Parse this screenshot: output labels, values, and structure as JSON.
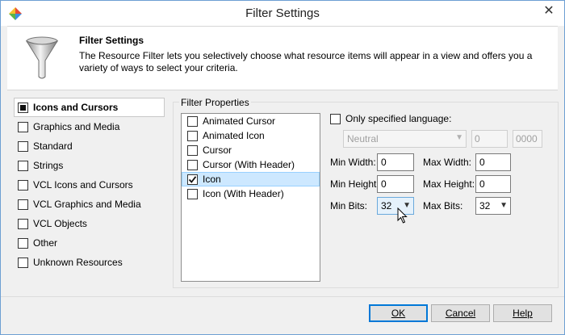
{
  "window": {
    "title": "Filter Settings",
    "close_symbol": "✕"
  },
  "header": {
    "title": "Filter Settings",
    "description": "The Resource Filter lets you selectively choose what resource items will appear in a view and offers you  a variety of ways to select your criteria."
  },
  "categories": [
    {
      "label": "Icons and Cursors",
      "checked": "partial",
      "selected": true
    },
    {
      "label": "Graphics and Media",
      "checked": false
    },
    {
      "label": "Standard",
      "checked": false
    },
    {
      "label": "Strings",
      "checked": false
    },
    {
      "label": "VCL Icons and Cursors",
      "checked": false
    },
    {
      "label": "VCL Graphics and Media",
      "checked": false
    },
    {
      "label": "VCL Objects",
      "checked": false
    },
    {
      "label": "Other",
      "checked": false
    },
    {
      "label": "Unknown Resources",
      "checked": false
    }
  ],
  "filter_properties": {
    "group_label": "Filter Properties",
    "items": [
      {
        "label": "Animated Cursor",
        "checked": false
      },
      {
        "label": "Animated Icon",
        "checked": false
      },
      {
        "label": "Cursor",
        "checked": false
      },
      {
        "label": "Cursor (With Header)",
        "checked": false
      },
      {
        "label": "Icon",
        "checked": true,
        "selected": true
      },
      {
        "label": "Icon (With Header)",
        "checked": false
      }
    ]
  },
  "language": {
    "checkbox_label": "Only specified language:",
    "checked": false,
    "selected_language": "Neutral",
    "id_value": "0",
    "hex_value": "0000"
  },
  "dimensions": {
    "min_width_label": "Min Width:",
    "min_width_value": "0",
    "max_width_label": "Max Width:",
    "max_width_value": "0",
    "min_height_label": "Min Height:",
    "min_height_value": "0",
    "max_height_label": "Max Height:",
    "max_height_value": "0",
    "min_bits_label": "Min Bits:",
    "min_bits_value": "32",
    "max_bits_label": "Max Bits:",
    "max_bits_value": "32"
  },
  "buttons": {
    "ok": "OK",
    "cancel": "Cancel",
    "help": "Help"
  }
}
